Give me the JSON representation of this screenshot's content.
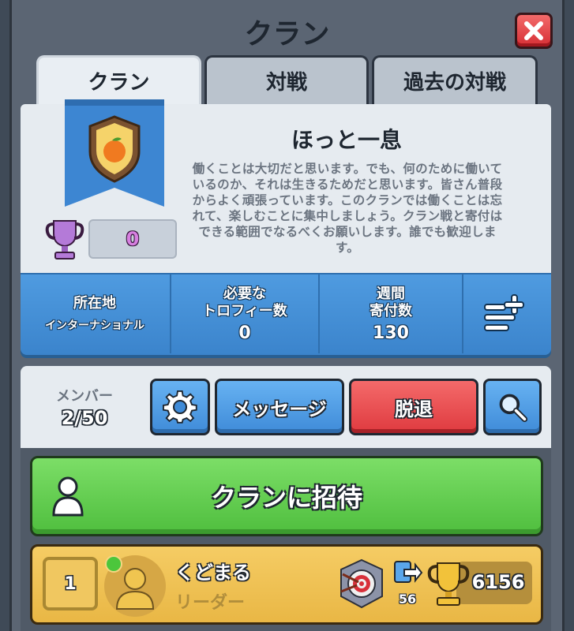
{
  "header": {
    "title": "クラン"
  },
  "tabs": [
    {
      "label": "クラン",
      "active": true
    },
    {
      "label": "対戦",
      "active": false
    },
    {
      "label": "過去の対戦",
      "active": false
    }
  ],
  "clan": {
    "name": "ほっと一息",
    "description": "働くことは大切だと思います。でも、何のために働いているのか、それは生きるためだと思います。皆さん普段からよく頑張っています。このクランでは働くことは忘れて、楽しむことに集中しましょう。クラン戦と寄付はできる範囲でなるべくお願いします。誰でも歓迎します。",
    "trophies": "0",
    "badge_icon": "orange-badge-icon"
  },
  "stats": {
    "location_label": "所在地",
    "location_value": "インターナショナル",
    "required_label_1": "必要な",
    "required_label_2": "トロフィー数",
    "required_value": "0",
    "donations_label_1": "週間",
    "donations_label_2": "寄付数",
    "donations_value": "130"
  },
  "members_bar": {
    "label": "メンバー",
    "count": "2/50",
    "message_label": "メッセージ",
    "leave_label": "脱退"
  },
  "invite": {
    "label": "クランに招待"
  },
  "members": [
    {
      "rank": "1",
      "name": "くどまる",
      "role": "リーダー",
      "donations": "56",
      "trophies": "6156",
      "online": true
    }
  ],
  "colors": {
    "blue": "#4f9be0",
    "red": "#df3a3f",
    "green": "#4fbe3e",
    "gold": "#f5cc64"
  }
}
